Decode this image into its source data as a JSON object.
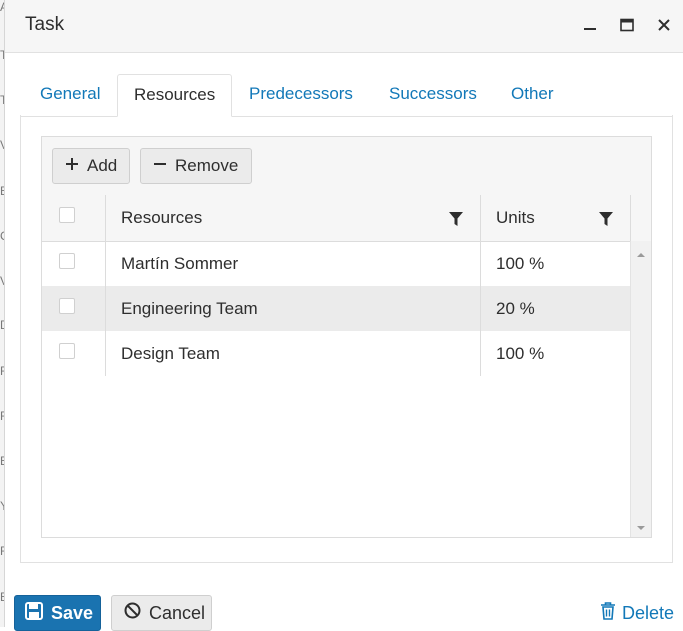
{
  "background_letters": [
    "A",
    "T",
    "T",
    "V",
    "E",
    "C",
    "V",
    "D",
    "F",
    "F",
    "E",
    "Y",
    "F",
    "E"
  ],
  "window": {
    "title": "Task"
  },
  "tabs": [
    {
      "label": "General",
      "active": false
    },
    {
      "label": "Resources",
      "active": true
    },
    {
      "label": "Predecessors",
      "active": false
    },
    {
      "label": "Successors",
      "active": false
    },
    {
      "label": "Other",
      "active": false
    }
  ],
  "toolbar": {
    "add_label": "Add",
    "remove_label": "Remove"
  },
  "columns": {
    "resources": "Resources",
    "units": "Units"
  },
  "rows": [
    {
      "resource": "Martín Sommer",
      "units": "100 %"
    },
    {
      "resource": "Engineering Team",
      "units": "20 %"
    },
    {
      "resource": "Design Team",
      "units": "100 %"
    }
  ],
  "footer": {
    "save_label": "Save",
    "cancel_label": "Cancel",
    "delete_label": "Delete"
  },
  "colors": {
    "accent": "#1278b8",
    "primary_button": "#1a73b0",
    "row_alternate": "#ebebeb"
  }
}
